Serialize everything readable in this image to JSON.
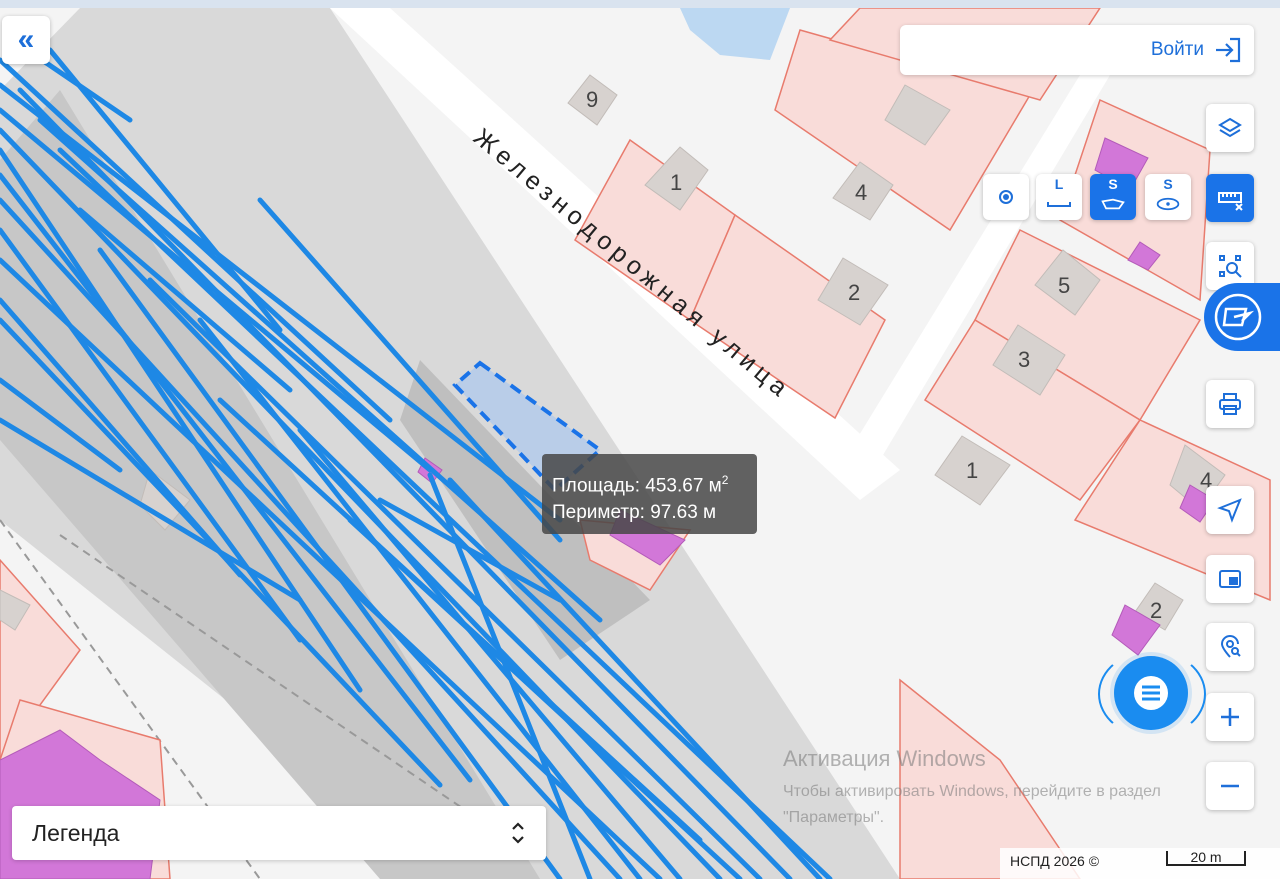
{
  "header": {
    "collapse_icon": "«",
    "login_label": "Войти"
  },
  "map": {
    "street_name": "Железнодорожная улица",
    "house_numbers": [
      "9",
      "1",
      "4",
      "2",
      "5",
      "3",
      "1",
      "4",
      "2"
    ],
    "colors": {
      "parcel_fill": "#f9dcd9",
      "parcel_line": "#e87b6d",
      "building": "#d7d2cf",
      "railway": "#cfcfcf",
      "track": "#1e88e5",
      "selection": "#b9cde8",
      "magenta": "#d277d8"
    }
  },
  "measure": {
    "area_label": "Площадь:",
    "area_value": "453.67 м",
    "area_unit_sup": "2",
    "perimeter_label": "Периметр:",
    "perimeter_value": "97.63 м"
  },
  "toolbar": {
    "point_icon": "point-tool-icon",
    "line_tool_label": "L",
    "area_tool_label": "S",
    "circle_area_label": "S"
  },
  "legend": {
    "label": "Легенда"
  },
  "watermark": {
    "title": "Активация Windows",
    "body": "Чтобы активировать Windows, перейдите в раздел \"Параметры\"."
  },
  "footer": {
    "copyright": "НСПД 2026 ©",
    "scale": "20 m"
  }
}
